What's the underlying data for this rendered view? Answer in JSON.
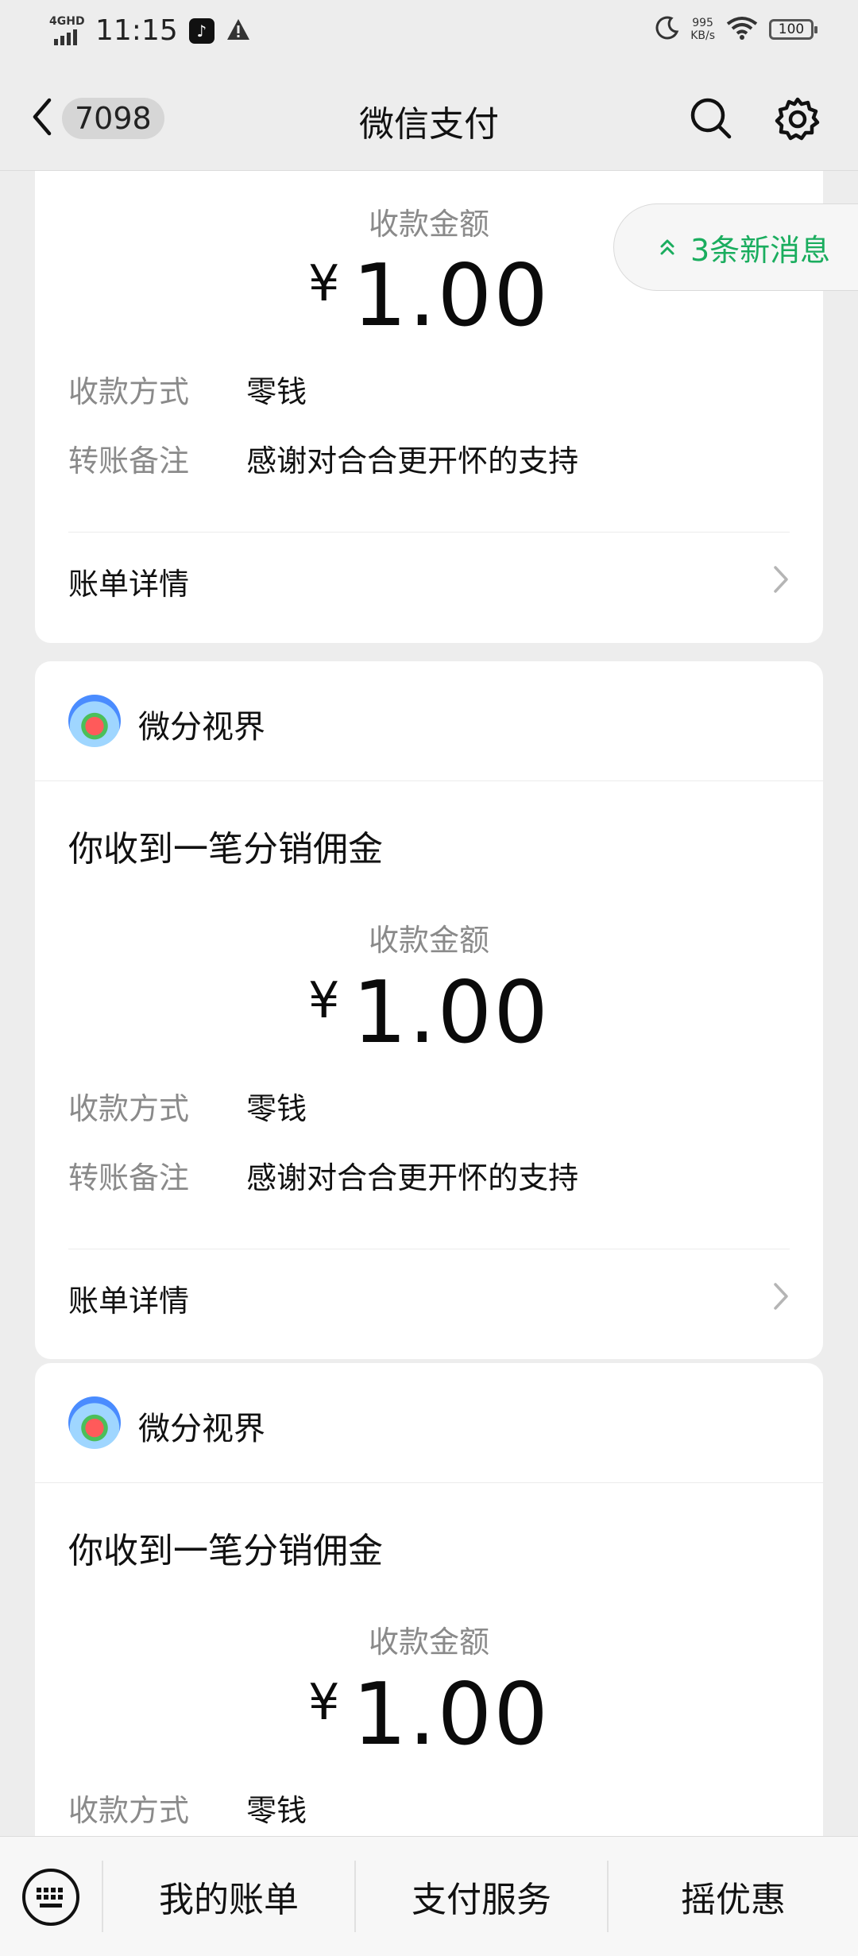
{
  "status_bar": {
    "network": "4GHD",
    "time": "11:15",
    "speed_value": "995",
    "speed_unit": "KB/s",
    "battery": "100",
    "icons": [
      "tiktok-icon",
      "warning-icon",
      "moon-icon",
      "wifi-icon",
      "battery-icon"
    ]
  },
  "nav": {
    "unread_count": "7098",
    "title": "微信支付",
    "icons": [
      "back-chevron-icon",
      "search-icon",
      "gear-icon"
    ]
  },
  "new_messages": "3条新消息",
  "cards": [
    {
      "amount_label": "收款金额",
      "currency": "¥",
      "amount": "1.00",
      "method_key": "收款方式",
      "method_val": "零钱",
      "note_key": "转账备注",
      "note_val": "感谢对合合更开怀的支持",
      "bill_detail": "账单详情"
    },
    {
      "channel_name": "微分视界",
      "message_title": "你收到一笔分销佣金",
      "amount_label": "收款金额",
      "currency": "¥",
      "amount": "1.00",
      "method_key": "收款方式",
      "method_val": "零钱",
      "note_key": "转账备注",
      "note_val": "感谢对合合更开怀的支持",
      "bill_detail": "账单详情"
    },
    {
      "channel_name": "微分视界",
      "message_title": "你收到一笔分销佣金",
      "amount_label": "收款金额",
      "currency": "¥",
      "amount": "1.00",
      "method_key": "收款方式",
      "method_val": "零钱"
    }
  ],
  "bottom_bar": {
    "items": [
      "我的账单",
      "支付服务",
      "摇优惠"
    ]
  },
  "colors": {
    "background": "#ededed",
    "card": "#ffffff",
    "accent_green": "#1aad5e",
    "muted_text": "#8a8a8a"
  }
}
